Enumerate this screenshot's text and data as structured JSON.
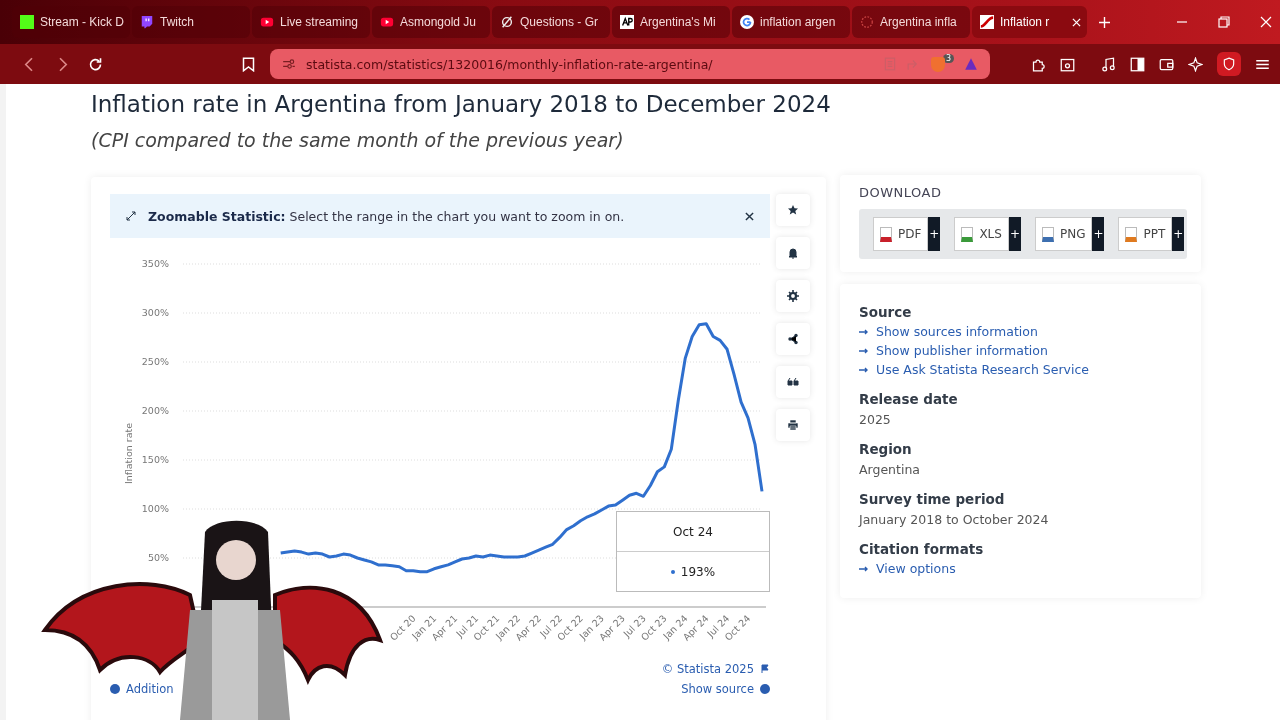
{
  "browser": {
    "tabs": [
      {
        "label": "Stream - Kick D",
        "selected": false
      },
      {
        "label": "Twitch",
        "selected": false
      },
      {
        "label": "Live streaming",
        "selected": false
      },
      {
        "label": "Asmongold Ju",
        "selected": false
      },
      {
        "label": "Questions - Gr",
        "selected": false
      },
      {
        "label": "Argentina's Mi",
        "selected": false
      },
      {
        "label": "inflation argen",
        "selected": false
      },
      {
        "label": "Argentina infla",
        "selected": false
      },
      {
        "label": "Inflation r",
        "selected": true
      }
    ],
    "address": "statista.com/statistics/1320016/monthly-inflation-rate-argentina/",
    "shields_badge": "3"
  },
  "page": {
    "title": "Inflation rate in Argentina from January 2018 to December 2024",
    "subtitle": "(CPI compared to the same month of the previous year)",
    "banner": "**Zoomable Statistic:** Select the range in the chart you want to zoom in on.",
    "chart_data": {
      "type": "line",
      "ylabel": "Inflation rate",
      "ylim": [
        0,
        350
      ],
      "grid": true,
      "categories": [
        null,
        null,
        null,
        null,
        null,
        null,
        null,
        null,
        null,
        null,
        null,
        null,
        null,
        null,
        null,
        null,
        null,
        null,
        null,
        null,
        null,
        null,
        null,
        null,
        null,
        null,
        null,
        null,
        null,
        null,
        null,
        null,
        null,
        "Oct 20",
        null,
        null,
        "Jan 21",
        null,
        null,
        "Apr 21",
        null,
        null,
        "Jul 21",
        null,
        null,
        "Oct 21",
        null,
        null,
        "Jan 22",
        null,
        null,
        "Apr 22",
        null,
        null,
        "Jul 22",
        null,
        null,
        "Oct 22",
        null,
        null,
        "Jan 23",
        null,
        null,
        "Apr 23",
        null,
        null,
        "Jul 23",
        null,
        null,
        "Oct 23",
        null,
        null,
        "Jan 24",
        null,
        null,
        "Apr 24",
        null,
        null,
        "Jul 24",
        null,
        null,
        "Oct 24",
        null,
        null
      ],
      "yticks": [
        {
          "value": 50,
          "label": "50%"
        },
        {
          "value": 100,
          "label": "100%"
        },
        {
          "value": 150,
          "label": "150%"
        },
        {
          "value": 200,
          "label": "200%"
        },
        {
          "value": 250,
          "label": "250%"
        },
        {
          "value": 300,
          "label": "300%"
        },
        {
          "value": 350,
          "label": "350%"
        }
      ],
      "series": [
        {
          "color": "#2f6fce",
          "values": [
            null,
            null,
            null,
            null,
            null,
            null,
            null,
            null,
            null,
            null,
            null,
            null,
            null,
            null,
            55,
            56,
            57,
            56,
            54,
            55,
            54,
            51,
            52,
            54,
            53,
            50,
            48,
            46,
            43,
            43,
            42,
            41,
            37,
            37,
            36,
            36,
            39,
            41,
            43,
            46,
            49,
            50,
            52,
            51,
            53,
            52,
            51,
            51,
            51,
            52,
            55,
            58,
            61,
            64,
            71,
            79,
            83,
            88,
            92,
            95,
            99,
            103,
            104,
            109,
            114,
            116,
            113,
            124,
            138,
            143,
            161,
            211,
            254,
            276,
            288,
            289,
            276,
            272,
            263,
            237,
            209,
            193,
            166,
            118
          ]
        }
      ]
    },
    "tooltip": {
      "label": "Oct 24",
      "value": "193%"
    },
    "copyright": "© Statista 2025",
    "show_source": "Show source",
    "additional": "Addition",
    "download": {
      "heading": "DOWNLOAD",
      "formats": [
        "PDF",
        "XLS",
        "PNG",
        "PPT"
      ],
      "more": "+"
    },
    "details": [
      {
        "title": "Source",
        "links": [
          "Show sources information",
          "Show publisher information",
          "Use Ask Statista Research Service"
        ]
      },
      {
        "title": "Release date",
        "value": "2025"
      },
      {
        "title": "Region",
        "value": "Argentina"
      },
      {
        "title": "Survey time period",
        "value": "January 2018 to October 2024"
      },
      {
        "title": "Citation formats",
        "links": [
          "View options"
        ]
      }
    ]
  }
}
